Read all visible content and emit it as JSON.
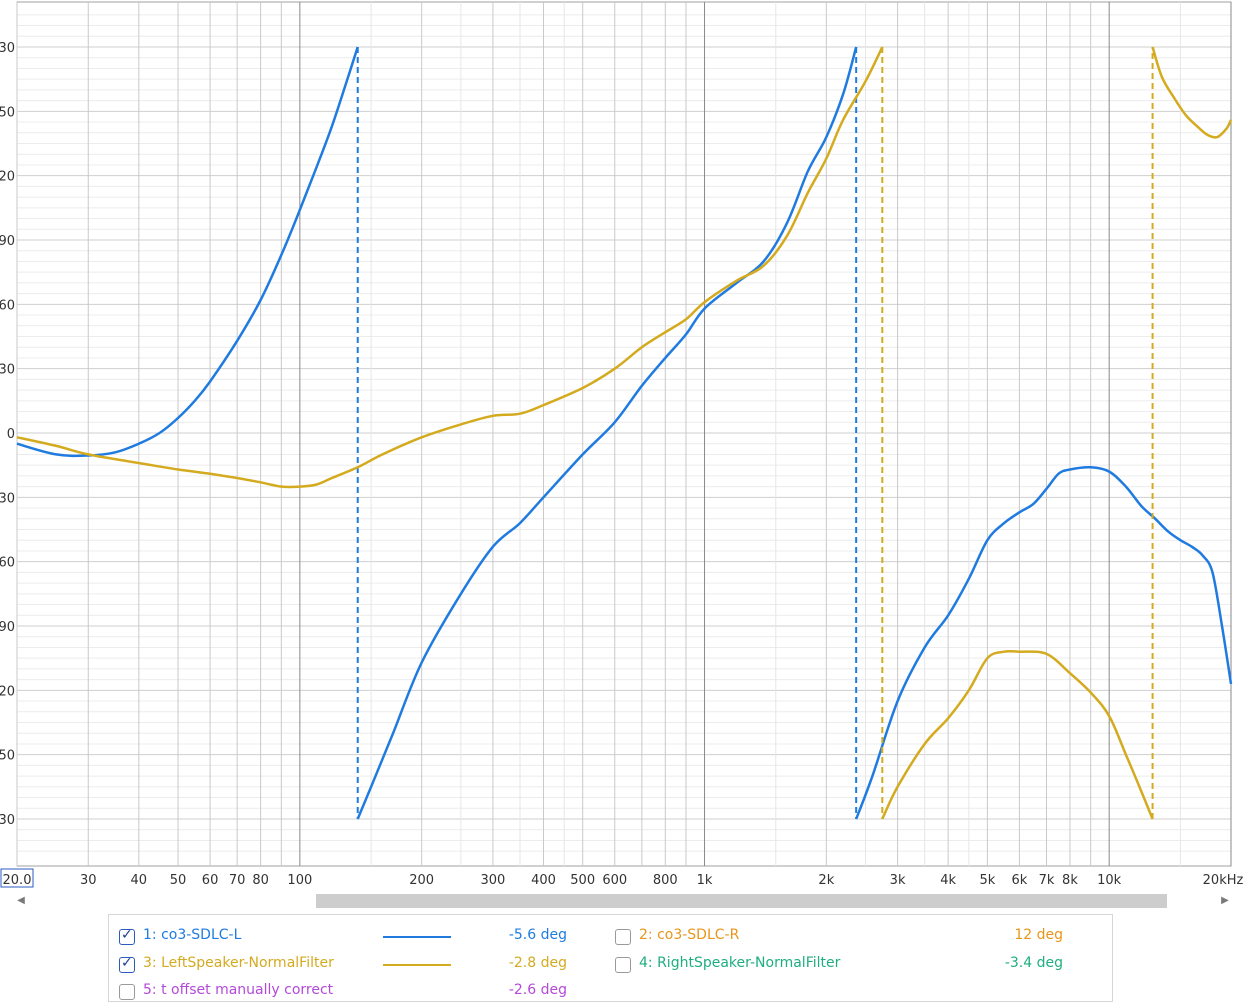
{
  "chart_data": {
    "type": "line",
    "x_scale": "log",
    "x_range": [
      20,
      20000
    ],
    "y_range": [
      -195,
      195
    ],
    "y_ticks": [
      180,
      150,
      120,
      90,
      60,
      30,
      0,
      -30,
      -60,
      -90,
      -120,
      -150,
      -180
    ],
    "y_tick_labels": [
      "30",
      "50",
      "20",
      "90",
      "60",
      "30",
      "0",
      "30",
      "60",
      "90",
      "20",
      "50",
      "30"
    ],
    "x_ticks": [
      20,
      30,
      40,
      50,
      60,
      70,
      80,
      100,
      200,
      300,
      400,
      500,
      600,
      800,
      1000,
      2000,
      3000,
      4000,
      5000,
      6000,
      7000,
      8000,
      10000,
      20000
    ],
    "x_tick_labels": [
      "20.0",
      "30",
      "40",
      "50",
      "60",
      "70",
      "80",
      "100",
      "200",
      "300",
      "400",
      "500",
      "600",
      "800",
      "1k",
      "2k",
      "3k",
      "4k",
      "5k",
      "6k",
      "7k",
      "8k",
      "10k",
      "20kHz"
    ],
    "grid": true,
    "wrap_deg": 180,
    "series": [
      {
        "name": "1: co3-SDLC-L",
        "color": "#1f7be0",
        "points": [
          [
            20,
            -5
          ],
          [
            25,
            -10
          ],
          [
            30,
            -10.5
          ],
          [
            35,
            -9
          ],
          [
            40,
            -5
          ],
          [
            45,
            0
          ],
          [
            50,
            7
          ],
          [
            55,
            15
          ],
          [
            60,
            24
          ],
          [
            70,
            43
          ],
          [
            80,
            62
          ],
          [
            90,
            83
          ],
          [
            100,
            104
          ],
          [
            110,
            124
          ],
          [
            120,
            143
          ],
          [
            130,
            163
          ],
          [
            139,
            180
          ],
          [
            139,
            -180
          ],
          [
            150,
            -165
          ],
          [
            170,
            -140
          ],
          [
            200,
            -107
          ],
          [
            250,
            -75
          ],
          [
            300,
            -53
          ],
          [
            350,
            -42
          ],
          [
            400,
            -30
          ],
          [
            500,
            -10
          ],
          [
            600,
            5
          ],
          [
            700,
            22
          ],
          [
            800,
            35
          ],
          [
            900,
            46
          ],
          [
            1000,
            58
          ],
          [
            1200,
            70
          ],
          [
            1400,
            80
          ],
          [
            1600,
            98
          ],
          [
            1800,
            122
          ],
          [
            2000,
            138
          ],
          [
            2200,
            158
          ],
          [
            2370,
            180
          ],
          [
            2370,
            -180
          ],
          [
            2600,
            -160
          ],
          [
            3000,
            -125
          ],
          [
            3500,
            -100
          ],
          [
            4000,
            -85
          ],
          [
            4500,
            -68
          ],
          [
            5000,
            -50
          ],
          [
            5500,
            -42
          ],
          [
            6000,
            -37
          ],
          [
            6500,
            -33
          ],
          [
            7000,
            -26
          ],
          [
            7500,
            -19
          ],
          [
            8000,
            -17
          ],
          [
            9000,
            -16
          ],
          [
            10000,
            -18
          ],
          [
            11000,
            -25
          ],
          [
            12000,
            -34
          ],
          [
            13000,
            -40
          ],
          [
            14000,
            -46
          ],
          [
            15000,
            -50
          ],
          [
            16000,
            -53
          ],
          [
            17000,
            -57
          ],
          [
            18000,
            -65
          ],
          [
            19000,
            -90
          ],
          [
            20000,
            -117
          ]
        ]
      },
      {
        "name": "3: LeftSpeaker-NormalFilter",
        "color": "#d4aa1f",
        "points": [
          [
            20,
            -2
          ],
          [
            25,
            -6
          ],
          [
            30,
            -10
          ],
          [
            40,
            -14
          ],
          [
            50,
            -17
          ],
          [
            60,
            -19
          ],
          [
            70,
            -21
          ],
          [
            80,
            -23
          ],
          [
            90,
            -25
          ],
          [
            100,
            -25
          ],
          [
            110,
            -24
          ],
          [
            120,
            -21
          ],
          [
            139,
            -16
          ],
          [
            160,
            -10
          ],
          [
            200,
            -2
          ],
          [
            250,
            4
          ],
          [
            300,
            8
          ],
          [
            350,
            9
          ],
          [
            400,
            13
          ],
          [
            500,
            21
          ],
          [
            600,
            30
          ],
          [
            700,
            40
          ],
          [
            800,
            47
          ],
          [
            900,
            53
          ],
          [
            1000,
            61
          ],
          [
            1200,
            71
          ],
          [
            1400,
            78
          ],
          [
            1600,
            92
          ],
          [
            1800,
            112
          ],
          [
            2000,
            128
          ],
          [
            2200,
            146
          ],
          [
            2500,
            164
          ],
          [
            2750,
            180
          ],
          [
            2750,
            -180
          ],
          [
            3000,
            -165
          ],
          [
            3500,
            -145
          ],
          [
            4000,
            -133
          ],
          [
            4500,
            -120
          ],
          [
            5000,
            -105
          ],
          [
            5500,
            -102
          ],
          [
            6000,
            -102
          ],
          [
            7000,
            -103
          ],
          [
            8000,
            -112
          ],
          [
            9000,
            -121
          ],
          [
            10000,
            -132
          ],
          [
            11000,
            -150
          ],
          [
            12000,
            -167
          ],
          [
            12800,
            -180
          ],
          [
            12800,
            180
          ],
          [
            13500,
            166
          ],
          [
            14500,
            156
          ],
          [
            15500,
            148
          ],
          [
            16500,
            143
          ],
          [
            17500,
            139
          ],
          [
            18500,
            138
          ],
          [
            19500,
            142
          ],
          [
            20000,
            146
          ]
        ]
      }
    ]
  },
  "legend": {
    "items": [
      {
        "label": "1: co3-SDLC-L",
        "value": "-5.6 deg",
        "checked": true,
        "color": "#1f7be0",
        "line_color": "#1f7be0"
      },
      {
        "label": "2: co3-SDLC-R",
        "value": "12 deg",
        "checked": false,
        "color": "#e8961a",
        "line_color": ""
      },
      {
        "label": "3: LeftSpeaker-NormalFilter",
        "value": "-2.8 deg",
        "checked": true,
        "color": "#d4aa1f",
        "line_color": "#d4aa1f"
      },
      {
        "label": "4: RightSpeaker-NormalFilter",
        "value": "-3.4 deg",
        "checked": false,
        "color": "#1fae80",
        "line_color": ""
      },
      {
        "label": "5: t offset manually correct",
        "value": "-2.6 deg",
        "checked": false,
        "color": "#b44ad8",
        "line_color": ""
      }
    ]
  },
  "scrollbar": {
    "left_arrow": "◀",
    "right_arrow": "▶"
  }
}
